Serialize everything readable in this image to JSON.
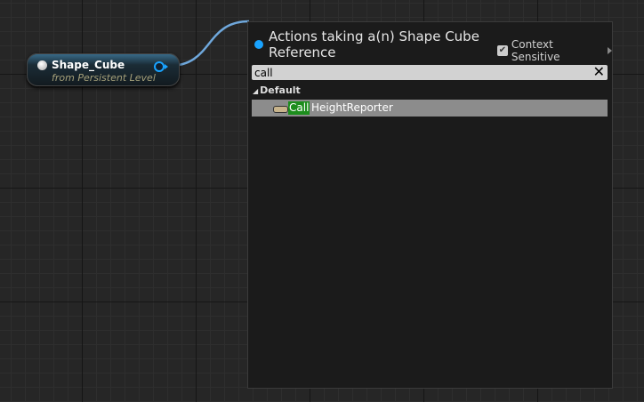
{
  "node": {
    "title": "Shape_Cube",
    "subtitle": "from Persistent Level"
  },
  "menu": {
    "heading": "Actions taking a(n) Shape Cube Reference",
    "context_sensitive_label": "Context Sensitive",
    "context_sensitive_checked": true,
    "search": {
      "value": "call"
    },
    "clear_icon": "✕",
    "category": "Default",
    "items": [
      {
        "match": "Call",
        "rest": " HeightReporter"
      }
    ]
  },
  "colors": {
    "accent": "#19a3ff",
    "match_highlight": "#1c8d1c"
  }
}
